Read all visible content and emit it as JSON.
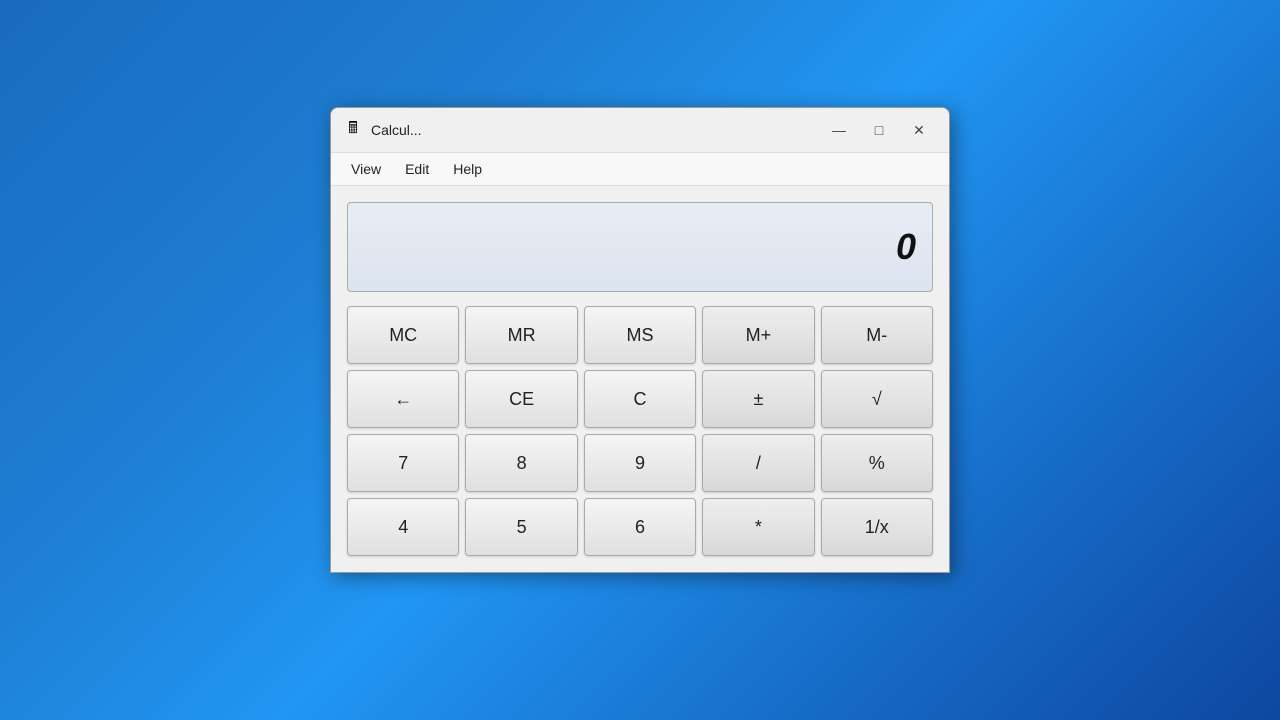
{
  "window": {
    "title": "Calcul...",
    "icon": "🖩"
  },
  "titlebar": {
    "minimize_label": "—",
    "maximize_label": "□",
    "close_label": "✕"
  },
  "menu": {
    "items": [
      {
        "label": "View"
      },
      {
        "label": "Edit"
      },
      {
        "label": "Help"
      }
    ]
  },
  "display": {
    "value": "0"
  },
  "buttons": {
    "memory_row": [
      {
        "label": "MC",
        "key": "mc"
      },
      {
        "label": "MR",
        "key": "mr"
      },
      {
        "label": "MS",
        "key": "ms"
      },
      {
        "label": "M+",
        "key": "mplus"
      },
      {
        "label": "M-",
        "key": "mminus"
      }
    ],
    "control_row": [
      {
        "label": "←",
        "key": "backspace"
      },
      {
        "label": "CE",
        "key": "ce"
      },
      {
        "label": "C",
        "key": "c"
      },
      {
        "label": "±",
        "key": "plusminus"
      },
      {
        "label": "√",
        "key": "sqrt"
      }
    ],
    "row7": [
      {
        "label": "7",
        "key": "7"
      },
      {
        "label": "8",
        "key": "8"
      },
      {
        "label": "9",
        "key": "9"
      },
      {
        "label": "/",
        "key": "divide"
      },
      {
        "label": "%",
        "key": "percent"
      }
    ],
    "row4": [
      {
        "label": "4",
        "key": "4"
      },
      {
        "label": "5",
        "key": "5"
      },
      {
        "label": "6",
        "key": "6"
      },
      {
        "label": "*",
        "key": "multiply"
      },
      {
        "label": "1/x",
        "key": "reciprocal"
      }
    ]
  }
}
